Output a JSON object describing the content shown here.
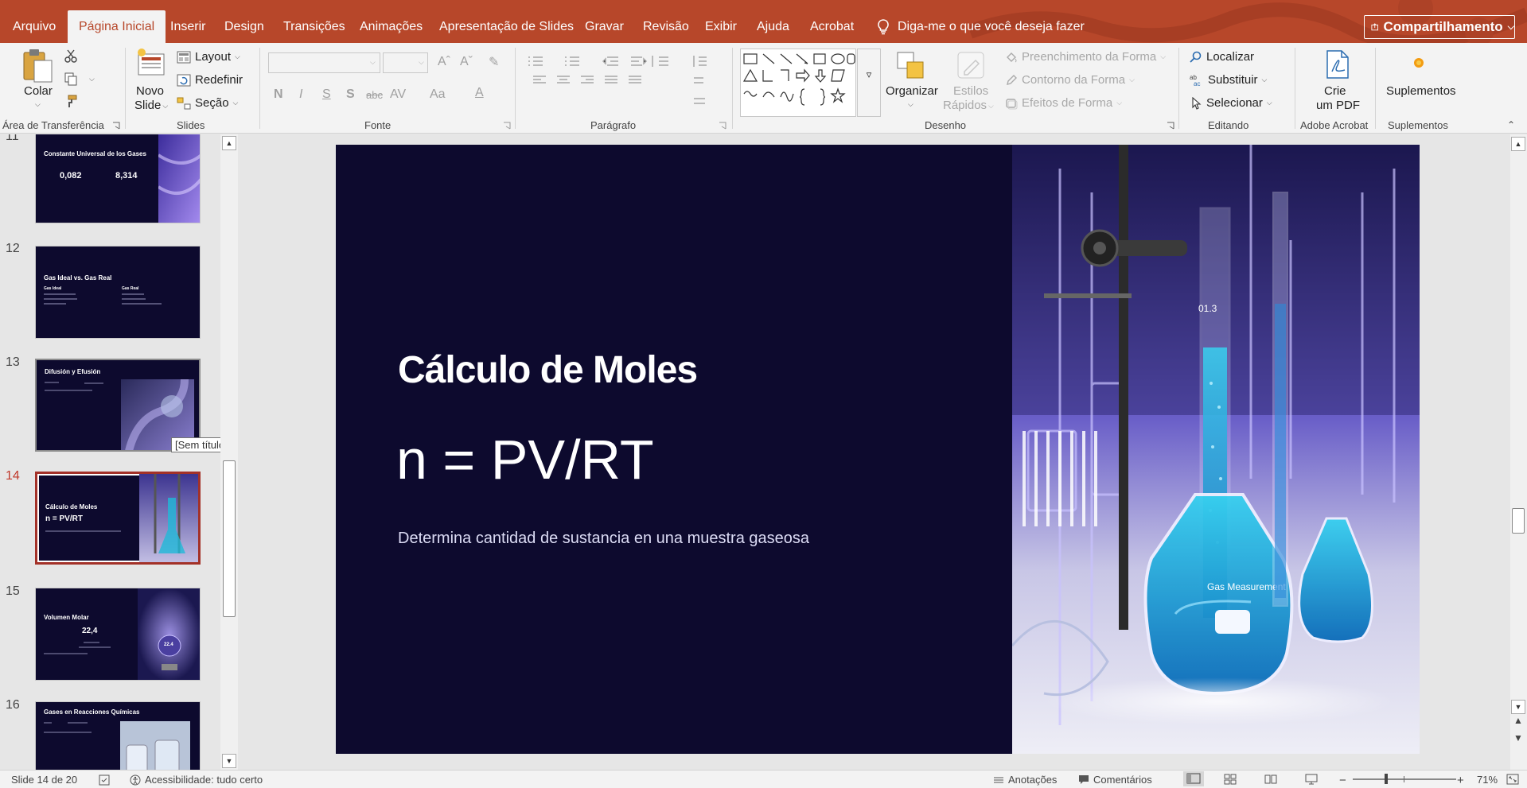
{
  "tabs": {
    "items": [
      {
        "label": "Arquivo"
      },
      {
        "label": "Página Inicial"
      },
      {
        "label": "Inserir"
      },
      {
        "label": "Design"
      },
      {
        "label": "Transições"
      },
      {
        "label": "Animações"
      },
      {
        "label": "Apresentação de Slides"
      },
      {
        "label": "Gravar"
      },
      {
        "label": "Revisão"
      },
      {
        "label": "Exibir"
      },
      {
        "label": "Ajuda"
      },
      {
        "label": "Acrobat"
      }
    ],
    "tell_me": "Diga-me o que você deseja fazer",
    "share_label": "Compartilhamento"
  },
  "ribbon": {
    "clipboard": {
      "paste": "Colar",
      "group": "Área de Transferência"
    },
    "slides": {
      "new_slide_line1": "Novo",
      "new_slide_line2": "Slide",
      "layout": "Layout",
      "reset": "Redefinir",
      "section": "Seção",
      "group": "Slides"
    },
    "font": {
      "group": "Fonte"
    },
    "paragraph": {
      "group": "Parágrafo"
    },
    "drawing": {
      "arrange": "Organizar",
      "quick_styles_line1": "Estilos",
      "quick_styles_line2": "Rápidos",
      "shape_fill": "Preenchimento da Forma",
      "shape_outline": "Contorno da Forma",
      "shape_effects": "Efeitos de Forma",
      "group": "Desenho"
    },
    "editing": {
      "find": "Localizar",
      "replace": "Substituir",
      "select": "Selecionar",
      "group": "Editando"
    },
    "acrobat": {
      "create_pdf_line1": "Crie",
      "create_pdf_line2": "um PDF",
      "group": "Adobe Acrobat"
    },
    "addins": {
      "label": "Suplementos",
      "group": "Suplementos"
    }
  },
  "thumbnails": {
    "items": [
      {
        "number": "11",
        "title": "Constante Universal de los Gases",
        "v1": "0,082",
        "v2": "8,314"
      },
      {
        "number": "12",
        "title": "Gas Ideal vs. Gas Real",
        "c1": "Gas Ideal",
        "c2": "Gas Real"
      },
      {
        "number": "13",
        "title": "Difusión y Efusión"
      },
      {
        "number": "14",
        "title": "Cálculo de Moles",
        "formula": "n = PV/RT"
      },
      {
        "number": "15",
        "title": "Volumen Molar",
        "value": "22,4",
        "badge": "22.4"
      },
      {
        "number": "16",
        "title": "Gases en Reacciones Químicas"
      }
    ],
    "tooltip": "[Sem título]"
  },
  "slide": {
    "title": "Cálculo de Moles",
    "formula": "n = PV/RT",
    "subtitle": "Determina cantidad de sustancia en una muestra gaseosa",
    "photo_label": "Gas Measurement",
    "photo_tube_label": "01.3"
  },
  "status": {
    "slide_counter": "Slide 14 de 20",
    "accessibility": "Acessibilidade: tudo certo",
    "notes": "Anotações",
    "comments": "Comentários",
    "zoom": "71%"
  },
  "colors": {
    "accent": "#b7472a",
    "slide_bg": "#0d0a2e",
    "selection": "#a33128"
  }
}
